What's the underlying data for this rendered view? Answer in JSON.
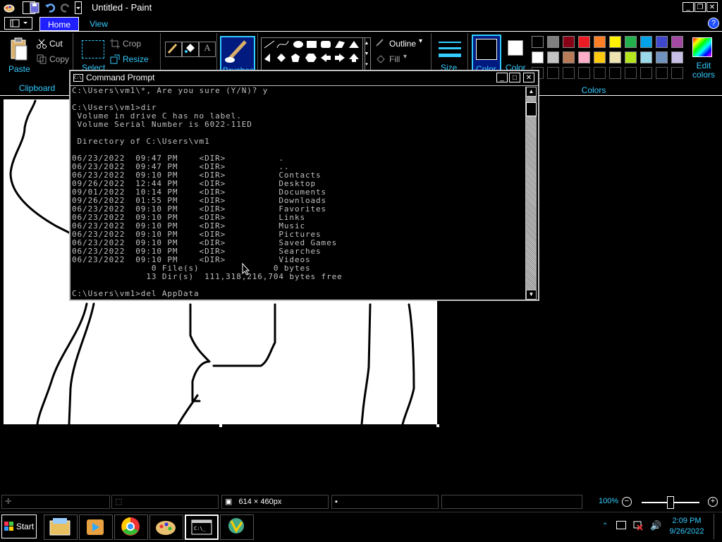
{
  "window": {
    "title": "Untitled - Paint"
  },
  "ribbon": {
    "tabs": [
      {
        "label": "Home"
      },
      {
        "label": "View"
      }
    ],
    "clipboard": {
      "paste": "Paste",
      "cut": "Cut",
      "copy": "Copy",
      "group_label": "Clipboard"
    },
    "image": {
      "select": "Select",
      "crop": "Crop",
      "resize": "Resize"
    },
    "brushes": "Brushes",
    "shapes": {
      "outline": "Outline",
      "fill": "Fill"
    },
    "size": "Size",
    "color1": "Color",
    "color2": "Color",
    "colors_group_label": "Colors",
    "edit_colors": "Edit colors",
    "palette_row1": [
      "#000000",
      "#7f7f7f",
      "#880015",
      "#ed1c24",
      "#ff7f27",
      "#fff200",
      "#22b14c",
      "#00a2e8",
      "#3f48cc",
      "#a349a4"
    ],
    "palette_row2": [
      "#ffffff",
      "#c3c3c3",
      "#b97a57",
      "#ffaec9",
      "#ffc90e",
      "#efe4b0",
      "#b5e61d",
      "#99d9ea",
      "#7092be",
      "#c8bfe7"
    ],
    "color1_value": "#000000",
    "color2_value": "#ffffff"
  },
  "cmd": {
    "title": "Command Prompt",
    "lines": [
      "C:\\Users\\vm1\\*, Are you sure (Y/N)? y",
      "",
      "C:\\Users\\vm1>dir",
      " Volume in drive C has no label.",
      " Volume Serial Number is 6022-11ED",
      "",
      " Directory of C:\\Users\\vm1",
      "",
      "06/23/2022  09:47 PM    <DIR>          .",
      "06/23/2022  09:47 PM    <DIR>          ..",
      "06/23/2022  09:10 PM    <DIR>          Contacts",
      "09/26/2022  12:44 PM    <DIR>          Desktop",
      "09/01/2022  10:14 PM    <DIR>          Documents",
      "09/26/2022  01:55 PM    <DIR>          Downloads",
      "06/23/2022  09:10 PM    <DIR>          Favorites",
      "06/23/2022  09:10 PM    <DIR>          Links",
      "06/23/2022  09:10 PM    <DIR>          Music",
      "06/23/2022  09:10 PM    <DIR>          Pictures",
      "06/23/2022  09:10 PM    <DIR>          Saved Games",
      "06/23/2022  09:10 PM    <DIR>          Searches",
      "06/23/2022  09:10 PM    <DIR>          Videos",
      "               0 File(s)              0 bytes",
      "              13 Dir(s)  111,318,216,704 bytes free",
      "",
      "C:\\Users\\vm1>del AppData"
    ]
  },
  "status": {
    "dimensions": "614 × 460px",
    "zoom": "100%"
  },
  "taskbar": {
    "start": "Start",
    "time": "2:09 PM",
    "date": "9/26/2022"
  }
}
